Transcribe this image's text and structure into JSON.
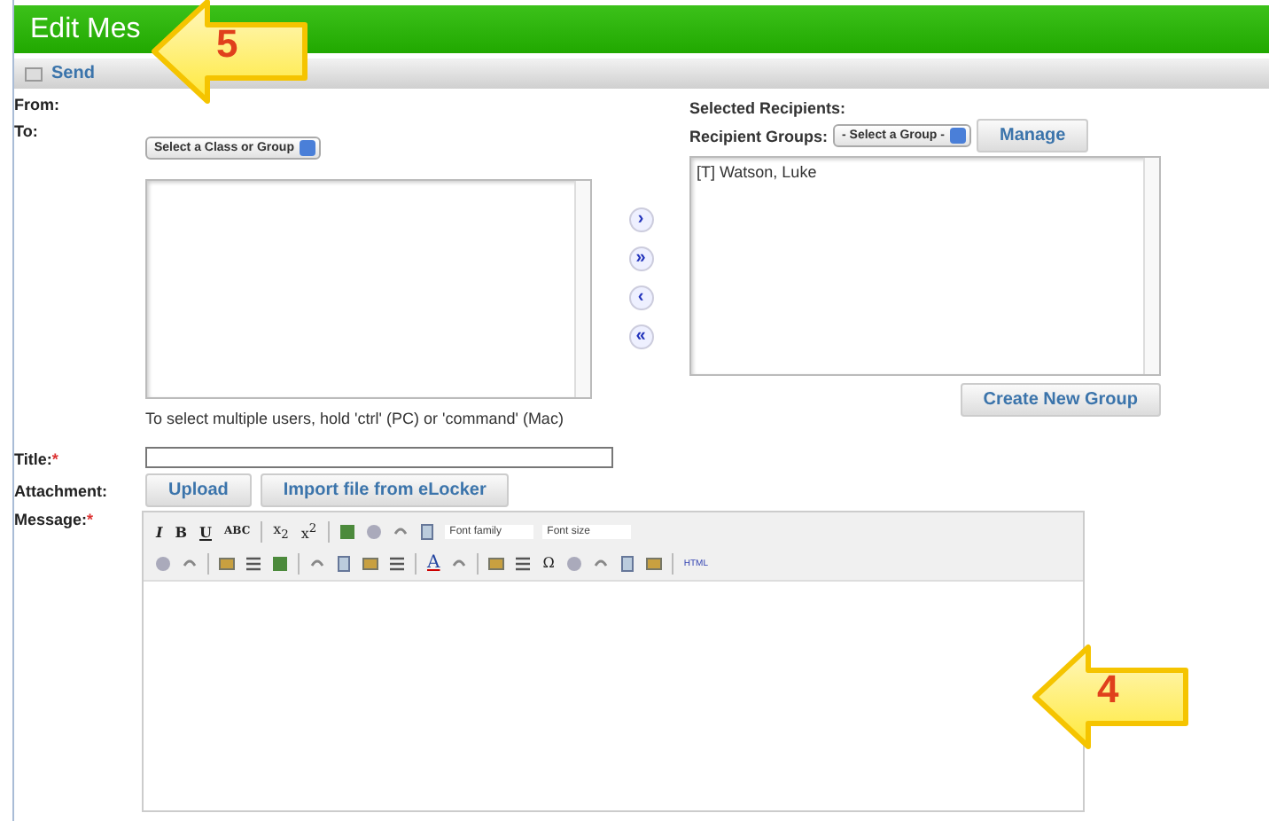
{
  "window": {
    "title": "Edit Mes"
  },
  "toolbar": {
    "send": "Send"
  },
  "form": {
    "from_label": "From:",
    "to_label": "To:",
    "class_select": "Select a Class or Group",
    "hint": "To select multiple users, hold 'ctrl' (PC) or 'command' (Mac)",
    "move_buttons": [
      "›",
      "»",
      "‹",
      "«"
    ],
    "selected_label": "Selected Recipients:",
    "groups_label": "Recipient Groups:",
    "group_select": "- Select a Group -",
    "manage": "Manage",
    "recipients": [
      "[T] Watson, Luke"
    ],
    "create_group": "Create New Group",
    "required_mark": "*",
    "title_label": "Title:",
    "title_required": true,
    "attachment_label": "Attachment:",
    "attachment_buttons": [
      "Upload",
      "Import file from eLocker"
    ],
    "message_label": "Message:",
    "message_required": true
  },
  "editor": {
    "rows": [
      [
        {
          "kind": "glyph",
          "label": "I"
        },
        {
          "kind": "glyph",
          "label": "B"
        },
        {
          "kind": "glyph",
          "label": "U"
        },
        {
          "kind": "glyph",
          "label": "ABC"
        },
        {
          "kind": "separator"
        },
        {
          "kind": "glyph",
          "label": "x$_{2}$"
        },
        {
          "kind": "glyph",
          "label": "x$^{2}$"
        },
        {
          "kind": "separator"
        },
        {
          "kind": "icon"
        },
        {
          "kind": "icon"
        },
        {
          "kind": "icon"
        },
        {
          "kind": "icon"
        },
        {
          "kind": "dropdown",
          "label": "Font family"
        },
        {
          "kind": "dropdown",
          "label": "Font size"
        }
      ],
      [
        {
          "kind": "icon"
        },
        {
          "kind": "icon"
        },
        {
          "kind": "separator"
        },
        {
          "kind": "icon"
        },
        {
          "kind": "icon"
        },
        {
          "kind": "icon"
        },
        {
          "kind": "separator"
        },
        {
          "kind": "icon"
        },
        {
          "kind": "icon"
        },
        {
          "kind": "icon"
        },
        {
          "kind": "icon"
        },
        {
          "kind": "separator"
        },
        {
          "kind": "glyph",
          "label": "A"
        },
        {
          "kind": "icon"
        },
        {
          "kind": "separator"
        },
        {
          "kind": "icon"
        },
        {
          "kind": "icon"
        },
        {
          "kind": "glyph",
          "label": "Ω"
        },
        {
          "kind": "icon"
        },
        {
          "kind": "icon"
        },
        {
          "kind": "icon"
        },
        {
          "kind": "icon"
        },
        {
          "kind": "separator"
        },
        {
          "kind": "glyph",
          "label": "HTML"
        }
      ]
    ]
  },
  "callouts": [
    {
      "number": "5"
    },
    {
      "number": "4"
    }
  ]
}
